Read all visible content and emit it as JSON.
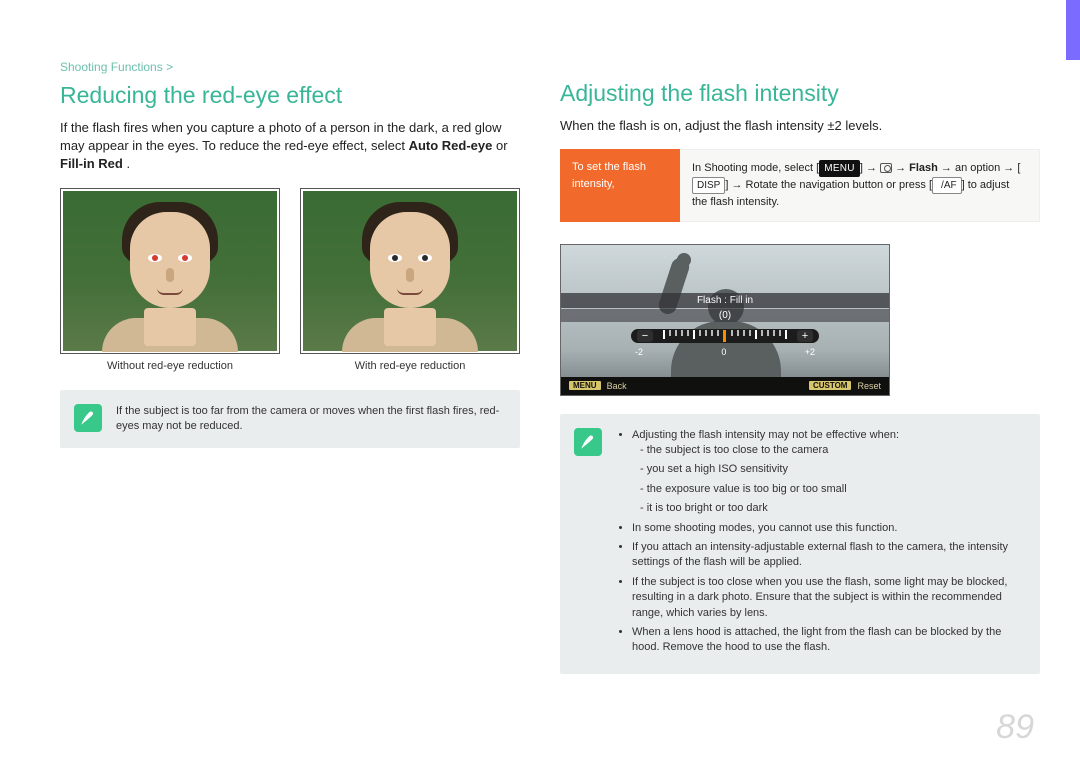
{
  "breadcrumb": "Shooting Functions >",
  "page_number": "89",
  "left": {
    "heading": "Reducing the red-eye effect",
    "intro": "If the flash fires when you capture a photo of a person in the dark, a red glow may appear in the eyes. To reduce the red-eye effect, select ",
    "intro_bold": "Auto Red-eye",
    "intro_mid": " or ",
    "intro_bold2": "Fill-in Red",
    "intro_end": ".",
    "caption_left": "Without red-eye reduction",
    "caption_right": "With red-eye reduction",
    "note": "If the subject is too far from the camera or moves when the first flash fires, red-eyes may not be reduced."
  },
  "right": {
    "heading": "Adjusting the flash intensity",
    "intro": "When the flash is on, adjust the flash intensity ±2 levels.",
    "inst_label": "To set the flash intensity,",
    "inst_body_pre": "In Shooting mode, select [",
    "inst_menu": "MENU",
    "inst_body_a": "] → ",
    "inst_body_b": " → ",
    "inst_flash": "Flash",
    "inst_body_c": " → an option → [",
    "inst_disp": "DISP",
    "inst_body_d": "] → Rotate the navigation button or press [",
    "inst_af": "  /AF",
    "inst_body_e": "] to adjust the flash intensity.",
    "lcd": {
      "title": "Flash : Fill in",
      "value": "(0)",
      "ticks": {
        "neg": "-2",
        "zero": "0",
        "pos": "+2"
      },
      "footer_back_btn": "MENU",
      "footer_back": "Back",
      "footer_reset_btn": "CUSTOM",
      "footer_reset": "Reset"
    },
    "notes": {
      "n1": "Adjusting the flash intensity may not be effective when:",
      "n1a": "the subject is too close to the camera",
      "n1b": "you set a high ISO sensitivity",
      "n1c": "the exposure value is too big or too small",
      "n1d": "it is too bright or too dark",
      "n2": "In some shooting modes, you cannot use this function.",
      "n3": "If you attach an intensity-adjustable external flash to the camera, the intensity settings of the flash will be applied.",
      "n4": "If the subject is too close when you use the flash, some light may be blocked, resulting in a dark photo. Ensure that the subject is within the recommended range, which varies by lens.",
      "n5": "When a lens hood is attached, the light from the flash can be blocked by the hood. Remove the hood to use the flash."
    }
  },
  "chart_data": {
    "type": "bar",
    "title": "Flash : Fill in",
    "xlabel": "",
    "ylabel": "",
    "categories": [
      "-2",
      "0",
      "+2"
    ],
    "values": [
      0
    ],
    "ylim": [
      -2,
      2
    ]
  }
}
